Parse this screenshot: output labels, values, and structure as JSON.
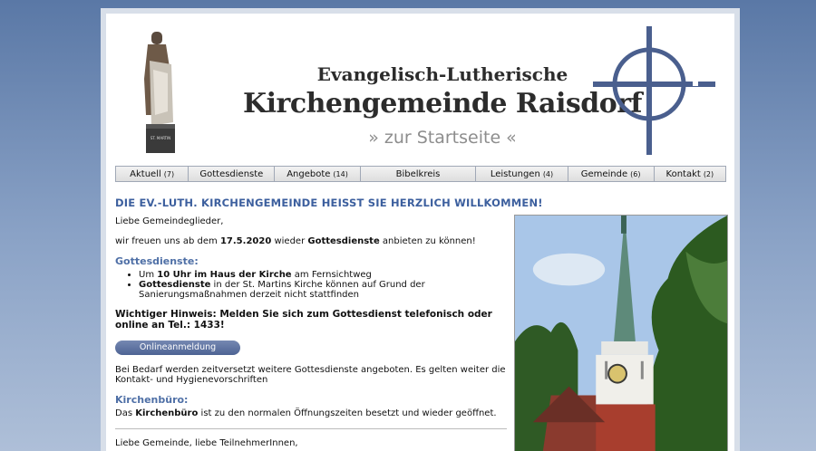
{
  "header": {
    "subtitle": "Evangelisch-Lutherische",
    "title": "Kirchengemeinde Raisdorf",
    "home_link": "» zur Startseite «",
    "statue_label": "ST. MARTIN"
  },
  "nav": [
    {
      "label": "Aktuell",
      "count": "(7)"
    },
    {
      "label": "Gottesdienste",
      "count": ""
    },
    {
      "label": "Angebote",
      "count": "(14)"
    },
    {
      "label": "Bibelkreis",
      "count": ""
    },
    {
      "label": "Leistungen",
      "count": "(4)"
    },
    {
      "label": "Gemeinde",
      "count": "(6)"
    },
    {
      "label": "Kontakt",
      "count": "(2)"
    }
  ],
  "main": {
    "page_title": "DIE EV.-LUTH. KIRCHENGEMEINDE HEISST SIE HERZLICH WILLKOMMEN!",
    "greeting": "Liebe Gemeindeglieder,",
    "intro": {
      "a": "wir freuen uns ab dem ",
      "date": "17.5.2020",
      "b": " wieder ",
      "bold": "Gottesdienste",
      "c": " anbieten zu können!"
    },
    "services_head": "Gottesdienste:",
    "bullets": [
      {
        "a": "Um ",
        "bold": "10 Uhr im Haus der Kirche",
        "b": " am Fernsichtweg"
      },
      {
        "bold": "Gottesdienste",
        "b": " in der St. Martins Kirche können auf Grund der Sanierungsmaßnahmen derzeit nicht stattfinden"
      }
    ],
    "warning": "Wichtiger Hinweis: Melden Sie sich zum Gottesdienst telefonisch oder online an Tel.: 1433!",
    "button_label": "Onlineanmeldung",
    "extra": "Bei Bedarf werden zeitversetzt weitere Gottesdienste angeboten. Es gelten weiter die Kontakt- und Hygienevorschriften",
    "office_head": "Kirchenbüro:",
    "office": {
      "a": "Das ",
      "bold": "Kirchenbüro",
      "b": " ist zu den normalen Öffnungszeiten besetzt und wieder geöffnet."
    },
    "closing": "Liebe Gemeinde, liebe TeilnehmerInnen,"
  },
  "colors": {
    "accent": "#3c5f9e",
    "cross": "#4a5f8e",
    "button": "#5a6f9e"
  }
}
